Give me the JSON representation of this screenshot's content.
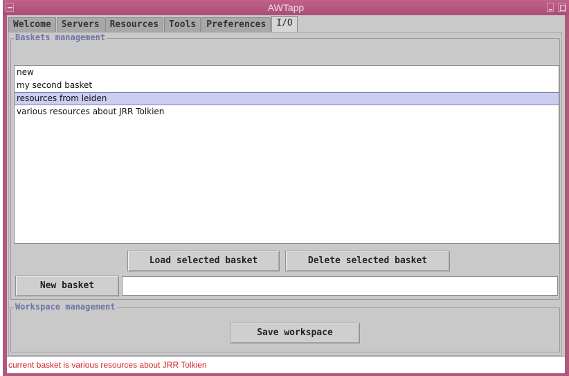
{
  "window": {
    "title": "AWTapp"
  },
  "tabs": [
    {
      "label": "Welcome"
    },
    {
      "label": "Servers"
    },
    {
      "label": "Resources"
    },
    {
      "label": "Tools"
    },
    {
      "label": "Preferences"
    },
    {
      "label": "I/O"
    }
  ],
  "active_tab": "I/O",
  "baskets": {
    "group_title": "Baskets management",
    "items": [
      {
        "label": "new"
      },
      {
        "label": "my second basket"
      },
      {
        "label": "resources from leiden"
      },
      {
        "label": "various resources about JRR Tolkien"
      }
    ],
    "selected_item": "resources from leiden",
    "load_label": "Load selected basket",
    "delete_label": "Delete selected basket",
    "new_label": "New basket",
    "new_value": ""
  },
  "workspace": {
    "group_title": "Workspace management",
    "save_label": "Save workspace"
  },
  "status": {
    "text": "current basket is various resources about JRR Tolkien"
  },
  "colors": {
    "title_bar": "#b0587e",
    "selection": "#cccdf0",
    "status_text": "#d8232a",
    "group_title": "#6f73a5"
  }
}
